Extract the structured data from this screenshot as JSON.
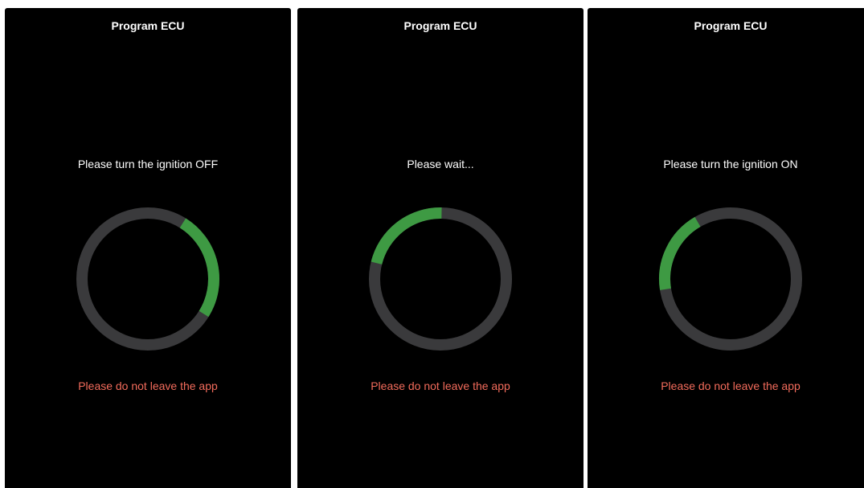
{
  "screens": [
    {
      "title": "Program ECU",
      "status": "Please turn the ignition OFF",
      "warning": "Please do not leave the app",
      "progress_arc": {
        "start_deg": 32,
        "end_deg": 122
      }
    },
    {
      "title": "Program ECU",
      "status": "Please wait...",
      "warning": "Please do not leave the app",
      "progress_arc": {
        "start_deg": 284,
        "end_deg": 361
      }
    },
    {
      "title": "Program ECU",
      "status": "Please turn the ignition ON",
      "warning": "Please do not leave the app",
      "progress_arc": {
        "start_deg": 261,
        "end_deg": 330
      }
    }
  ],
  "colors": {
    "background": "#000000",
    "track": "#3a3a3c",
    "progress": "#3e9a43",
    "warning": "#f26b5b",
    "text": "#ffffff"
  }
}
